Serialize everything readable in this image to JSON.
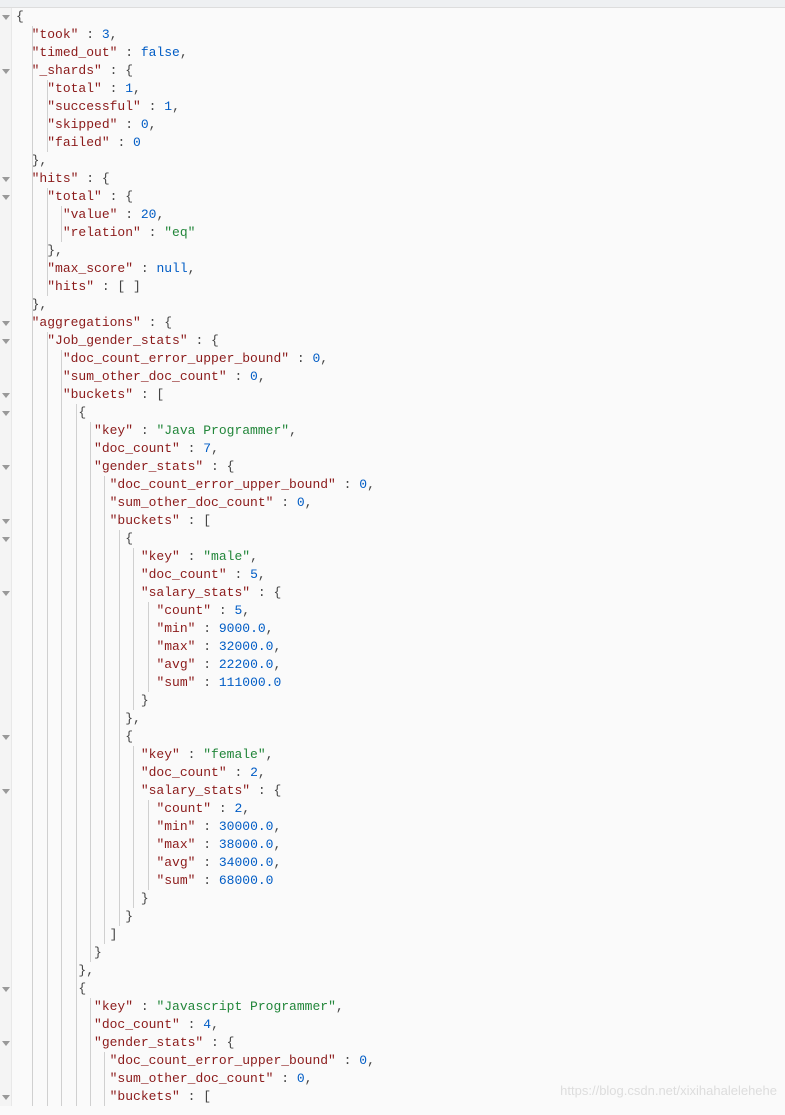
{
  "watermark": "https://blog.csdn.net/xixihahalelehehe",
  "indent_unit": "  ",
  "tokens_legend": {
    "k": "json-key",
    "s": "string-value",
    "n": "number-value",
    "b": "boolean-or-null",
    "p": "punctuation"
  },
  "json_response": {
    "took": 3,
    "timed_out": false,
    "_shards": {
      "total": 1,
      "successful": 1,
      "skipped": 0,
      "failed": 0
    },
    "hits": {
      "total": {
        "value": 20,
        "relation": "eq"
      },
      "max_score": null,
      "hits": []
    },
    "aggregations": {
      "Job_gender_stats": {
        "doc_count_error_upper_bound": 0,
        "sum_other_doc_count": 0,
        "buckets": [
          {
            "key": "Java Programmer",
            "doc_count": 7,
            "gender_stats": {
              "doc_count_error_upper_bound": 0,
              "sum_other_doc_count": 0,
              "buckets": [
                {
                  "key": "male",
                  "doc_count": 5,
                  "salary_stats": {
                    "count": 5,
                    "min": 9000.0,
                    "max": 32000.0,
                    "avg": 22200.0,
                    "sum": 111000.0
                  }
                },
                {
                  "key": "female",
                  "doc_count": 2,
                  "salary_stats": {
                    "count": 2,
                    "min": 30000.0,
                    "max": 38000.0,
                    "avg": 34000.0,
                    "sum": 68000.0
                  }
                }
              ]
            }
          },
          {
            "key": "Javascript Programmer",
            "doc_count": 4,
            "gender_stats": {
              "doc_count_error_upper_bound": 0,
              "sum_other_doc_count": 0,
              "buckets": []
            }
          }
        ]
      }
    }
  },
  "lines": [
    {
      "i": 0,
      "foldable": true,
      "t": [
        [
          "p",
          "{"
        ]
      ]
    },
    {
      "i": 1,
      "t": [
        [
          "k",
          "\"took\""
        ],
        [
          "p",
          " : "
        ],
        [
          "n",
          "3"
        ],
        [
          "p",
          ","
        ]
      ]
    },
    {
      "i": 1,
      "t": [
        [
          "k",
          "\"timed_out\""
        ],
        [
          "p",
          " : "
        ],
        [
          "b",
          "false"
        ],
        [
          "p",
          ","
        ]
      ]
    },
    {
      "i": 1,
      "foldable": true,
      "t": [
        [
          "k",
          "\"_shards\""
        ],
        [
          "p",
          " : {"
        ]
      ]
    },
    {
      "i": 2,
      "t": [
        [
          "k",
          "\"total\""
        ],
        [
          "p",
          " : "
        ],
        [
          "n",
          "1"
        ],
        [
          "p",
          ","
        ]
      ]
    },
    {
      "i": 2,
      "t": [
        [
          "k",
          "\"successful\""
        ],
        [
          "p",
          " : "
        ],
        [
          "n",
          "1"
        ],
        [
          "p",
          ","
        ]
      ]
    },
    {
      "i": 2,
      "t": [
        [
          "k",
          "\"skipped\""
        ],
        [
          "p",
          " : "
        ],
        [
          "n",
          "0"
        ],
        [
          "p",
          ","
        ]
      ]
    },
    {
      "i": 2,
      "t": [
        [
          "k",
          "\"failed\""
        ],
        [
          "p",
          " : "
        ],
        [
          "n",
          "0"
        ]
      ]
    },
    {
      "i": 1,
      "t": [
        [
          "p",
          "},"
        ]
      ]
    },
    {
      "i": 1,
      "foldable": true,
      "t": [
        [
          "k",
          "\"hits\""
        ],
        [
          "p",
          " : {"
        ]
      ]
    },
    {
      "i": 2,
      "foldable": true,
      "t": [
        [
          "k",
          "\"total\""
        ],
        [
          "p",
          " : {"
        ]
      ]
    },
    {
      "i": 3,
      "t": [
        [
          "k",
          "\"value\""
        ],
        [
          "p",
          " : "
        ],
        [
          "n",
          "20"
        ],
        [
          "p",
          ","
        ]
      ]
    },
    {
      "i": 3,
      "t": [
        [
          "k",
          "\"relation\""
        ],
        [
          "p",
          " : "
        ],
        [
          "s",
          "\"eq\""
        ]
      ]
    },
    {
      "i": 2,
      "t": [
        [
          "p",
          "},"
        ]
      ]
    },
    {
      "i": 2,
      "t": [
        [
          "k",
          "\"max_score\""
        ],
        [
          "p",
          " : "
        ],
        [
          "b",
          "null"
        ],
        [
          "p",
          ","
        ]
      ]
    },
    {
      "i": 2,
      "t": [
        [
          "k",
          "\"hits\""
        ],
        [
          "p",
          " : [ ]"
        ]
      ]
    },
    {
      "i": 1,
      "t": [
        [
          "p",
          "},"
        ]
      ]
    },
    {
      "i": 1,
      "foldable": true,
      "t": [
        [
          "k",
          "\"aggregations\""
        ],
        [
          "p",
          " : {"
        ]
      ]
    },
    {
      "i": 2,
      "foldable": true,
      "t": [
        [
          "k",
          "\"Job_gender_stats\""
        ],
        [
          "p",
          " : {"
        ]
      ]
    },
    {
      "i": 3,
      "t": [
        [
          "k",
          "\"doc_count_error_upper_bound\""
        ],
        [
          "p",
          " : "
        ],
        [
          "n",
          "0"
        ],
        [
          "p",
          ","
        ]
      ]
    },
    {
      "i": 3,
      "t": [
        [
          "k",
          "\"sum_other_doc_count\""
        ],
        [
          "p",
          " : "
        ],
        [
          "n",
          "0"
        ],
        [
          "p",
          ","
        ]
      ]
    },
    {
      "i": 3,
      "foldable": true,
      "t": [
        [
          "k",
          "\"buckets\""
        ],
        [
          "p",
          " : ["
        ]
      ]
    },
    {
      "i": 4,
      "foldable": true,
      "t": [
        [
          "p",
          "{"
        ]
      ]
    },
    {
      "i": 5,
      "t": [
        [
          "k",
          "\"key\""
        ],
        [
          "p",
          " : "
        ],
        [
          "s",
          "\"Java Programmer\""
        ],
        [
          "p",
          ","
        ]
      ]
    },
    {
      "i": 5,
      "t": [
        [
          "k",
          "\"doc_count\""
        ],
        [
          "p",
          " : "
        ],
        [
          "n",
          "7"
        ],
        [
          "p",
          ","
        ]
      ]
    },
    {
      "i": 5,
      "foldable": true,
      "t": [
        [
          "k",
          "\"gender_stats\""
        ],
        [
          "p",
          " : {"
        ]
      ]
    },
    {
      "i": 6,
      "t": [
        [
          "k",
          "\"doc_count_error_upper_bound\""
        ],
        [
          "p",
          " : "
        ],
        [
          "n",
          "0"
        ],
        [
          "p",
          ","
        ]
      ]
    },
    {
      "i": 6,
      "t": [
        [
          "k",
          "\"sum_other_doc_count\""
        ],
        [
          "p",
          " : "
        ],
        [
          "n",
          "0"
        ],
        [
          "p",
          ","
        ]
      ]
    },
    {
      "i": 6,
      "foldable": true,
      "t": [
        [
          "k",
          "\"buckets\""
        ],
        [
          "p",
          " : ["
        ]
      ]
    },
    {
      "i": 7,
      "foldable": true,
      "t": [
        [
          "p",
          "{"
        ]
      ]
    },
    {
      "i": 8,
      "t": [
        [
          "k",
          "\"key\""
        ],
        [
          "p",
          " : "
        ],
        [
          "s",
          "\"male\""
        ],
        [
          "p",
          ","
        ]
      ]
    },
    {
      "i": 8,
      "t": [
        [
          "k",
          "\"doc_count\""
        ],
        [
          "p",
          " : "
        ],
        [
          "n",
          "5"
        ],
        [
          "p",
          ","
        ]
      ]
    },
    {
      "i": 8,
      "foldable": true,
      "t": [
        [
          "k",
          "\"salary_stats\""
        ],
        [
          "p",
          " : {"
        ]
      ]
    },
    {
      "i": 9,
      "t": [
        [
          "k",
          "\"count\""
        ],
        [
          "p",
          " : "
        ],
        [
          "n",
          "5"
        ],
        [
          "p",
          ","
        ]
      ]
    },
    {
      "i": 9,
      "t": [
        [
          "k",
          "\"min\""
        ],
        [
          "p",
          " : "
        ],
        [
          "n",
          "9000.0"
        ],
        [
          "p",
          ","
        ]
      ]
    },
    {
      "i": 9,
      "t": [
        [
          "k",
          "\"max\""
        ],
        [
          "p",
          " : "
        ],
        [
          "n",
          "32000.0"
        ],
        [
          "p",
          ","
        ]
      ]
    },
    {
      "i": 9,
      "t": [
        [
          "k",
          "\"avg\""
        ],
        [
          "p",
          " : "
        ],
        [
          "n",
          "22200.0"
        ],
        [
          "p",
          ","
        ]
      ]
    },
    {
      "i": 9,
      "t": [
        [
          "k",
          "\"sum\""
        ],
        [
          "p",
          " : "
        ],
        [
          "n",
          "111000.0"
        ]
      ]
    },
    {
      "i": 8,
      "t": [
        [
          "p",
          "}"
        ]
      ]
    },
    {
      "i": 7,
      "t": [
        [
          "p",
          "},"
        ]
      ]
    },
    {
      "i": 7,
      "foldable": true,
      "t": [
        [
          "p",
          "{"
        ]
      ]
    },
    {
      "i": 8,
      "t": [
        [
          "k",
          "\"key\""
        ],
        [
          "p",
          " : "
        ],
        [
          "s",
          "\"female\""
        ],
        [
          "p",
          ","
        ]
      ]
    },
    {
      "i": 8,
      "t": [
        [
          "k",
          "\"doc_count\""
        ],
        [
          "p",
          " : "
        ],
        [
          "n",
          "2"
        ],
        [
          "p",
          ","
        ]
      ]
    },
    {
      "i": 8,
      "foldable": true,
      "t": [
        [
          "k",
          "\"salary_stats\""
        ],
        [
          "p",
          " : {"
        ]
      ]
    },
    {
      "i": 9,
      "t": [
        [
          "k",
          "\"count\""
        ],
        [
          "p",
          " : "
        ],
        [
          "n",
          "2"
        ],
        [
          "p",
          ","
        ]
      ]
    },
    {
      "i": 9,
      "t": [
        [
          "k",
          "\"min\""
        ],
        [
          "p",
          " : "
        ],
        [
          "n",
          "30000.0"
        ],
        [
          "p",
          ","
        ]
      ]
    },
    {
      "i": 9,
      "t": [
        [
          "k",
          "\"max\""
        ],
        [
          "p",
          " : "
        ],
        [
          "n",
          "38000.0"
        ],
        [
          "p",
          ","
        ]
      ]
    },
    {
      "i": 9,
      "t": [
        [
          "k",
          "\"avg\""
        ],
        [
          "p",
          " : "
        ],
        [
          "n",
          "34000.0"
        ],
        [
          "p",
          ","
        ]
      ]
    },
    {
      "i": 9,
      "t": [
        [
          "k",
          "\"sum\""
        ],
        [
          "p",
          " : "
        ],
        [
          "n",
          "68000.0"
        ]
      ]
    },
    {
      "i": 8,
      "t": [
        [
          "p",
          "}"
        ]
      ]
    },
    {
      "i": 7,
      "t": [
        [
          "p",
          "}"
        ]
      ]
    },
    {
      "i": 6,
      "t": [
        [
          "p",
          "]"
        ]
      ]
    },
    {
      "i": 5,
      "t": [
        [
          "p",
          "}"
        ]
      ]
    },
    {
      "i": 4,
      "t": [
        [
          "p",
          "},"
        ]
      ]
    },
    {
      "i": 4,
      "foldable": true,
      "t": [
        [
          "p",
          "{"
        ]
      ]
    },
    {
      "i": 5,
      "t": [
        [
          "k",
          "\"key\""
        ],
        [
          "p",
          " : "
        ],
        [
          "s",
          "\"Javascript Programmer\""
        ],
        [
          "p",
          ","
        ]
      ]
    },
    {
      "i": 5,
      "t": [
        [
          "k",
          "\"doc_count\""
        ],
        [
          "p",
          " : "
        ],
        [
          "n",
          "4"
        ],
        [
          "p",
          ","
        ]
      ]
    },
    {
      "i": 5,
      "foldable": true,
      "t": [
        [
          "k",
          "\"gender_stats\""
        ],
        [
          "p",
          " : {"
        ]
      ]
    },
    {
      "i": 6,
      "t": [
        [
          "k",
          "\"doc_count_error_upper_bound\""
        ],
        [
          "p",
          " : "
        ],
        [
          "n",
          "0"
        ],
        [
          "p",
          ","
        ]
      ]
    },
    {
      "i": 6,
      "t": [
        [
          "k",
          "\"sum_other_doc_count\""
        ],
        [
          "p",
          " : "
        ],
        [
          "n",
          "0"
        ],
        [
          "p",
          ","
        ]
      ]
    },
    {
      "i": 6,
      "foldable": true,
      "t": [
        [
          "k",
          "\"buckets\""
        ],
        [
          "p",
          " : ["
        ]
      ]
    }
  ]
}
